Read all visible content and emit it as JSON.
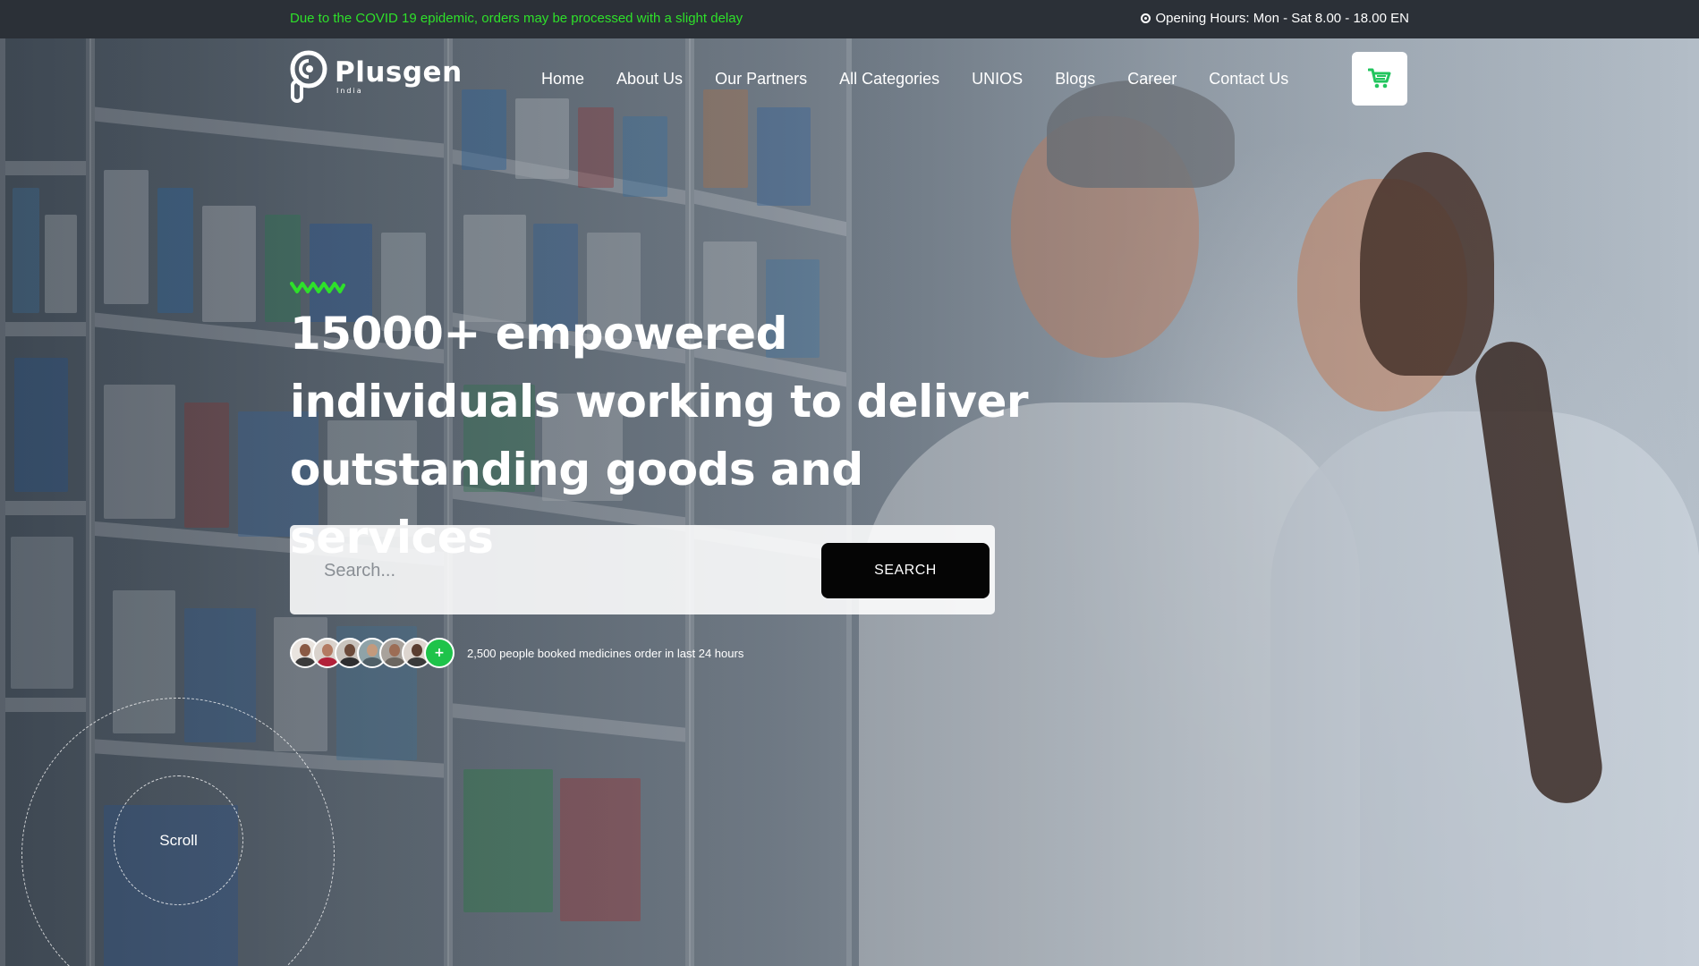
{
  "topbar": {
    "notice": "Due to the COVID 19 epidemic, orders may be processed with a slight delay",
    "hours": "Opening Hours: Mon - Sat 8.00 - 18.00 EN"
  },
  "header": {
    "logo_name": "Plusgen",
    "logo_sub": "India",
    "nav": [
      "Home",
      "About Us",
      "Our Partners",
      "All Categories",
      "UNIOS",
      "Blogs",
      "Career",
      "Contact Us"
    ],
    "cart_icon": "cart-icon"
  },
  "hero": {
    "headline": "15000+ empowered individuals working to deliver outstanding goods and services",
    "search_placeholder": "Search...",
    "search_button": "SEARCH",
    "avatar_plus": "+",
    "booked_text": "2,500 people booked medicines order in last 24 hours",
    "scroll_label": "Scroll"
  },
  "colors": {
    "accent": "#2ee02a",
    "topbar_bg": "#2b3037",
    "button_bg": "#050505",
    "plus_badge": "#1ec34a"
  }
}
